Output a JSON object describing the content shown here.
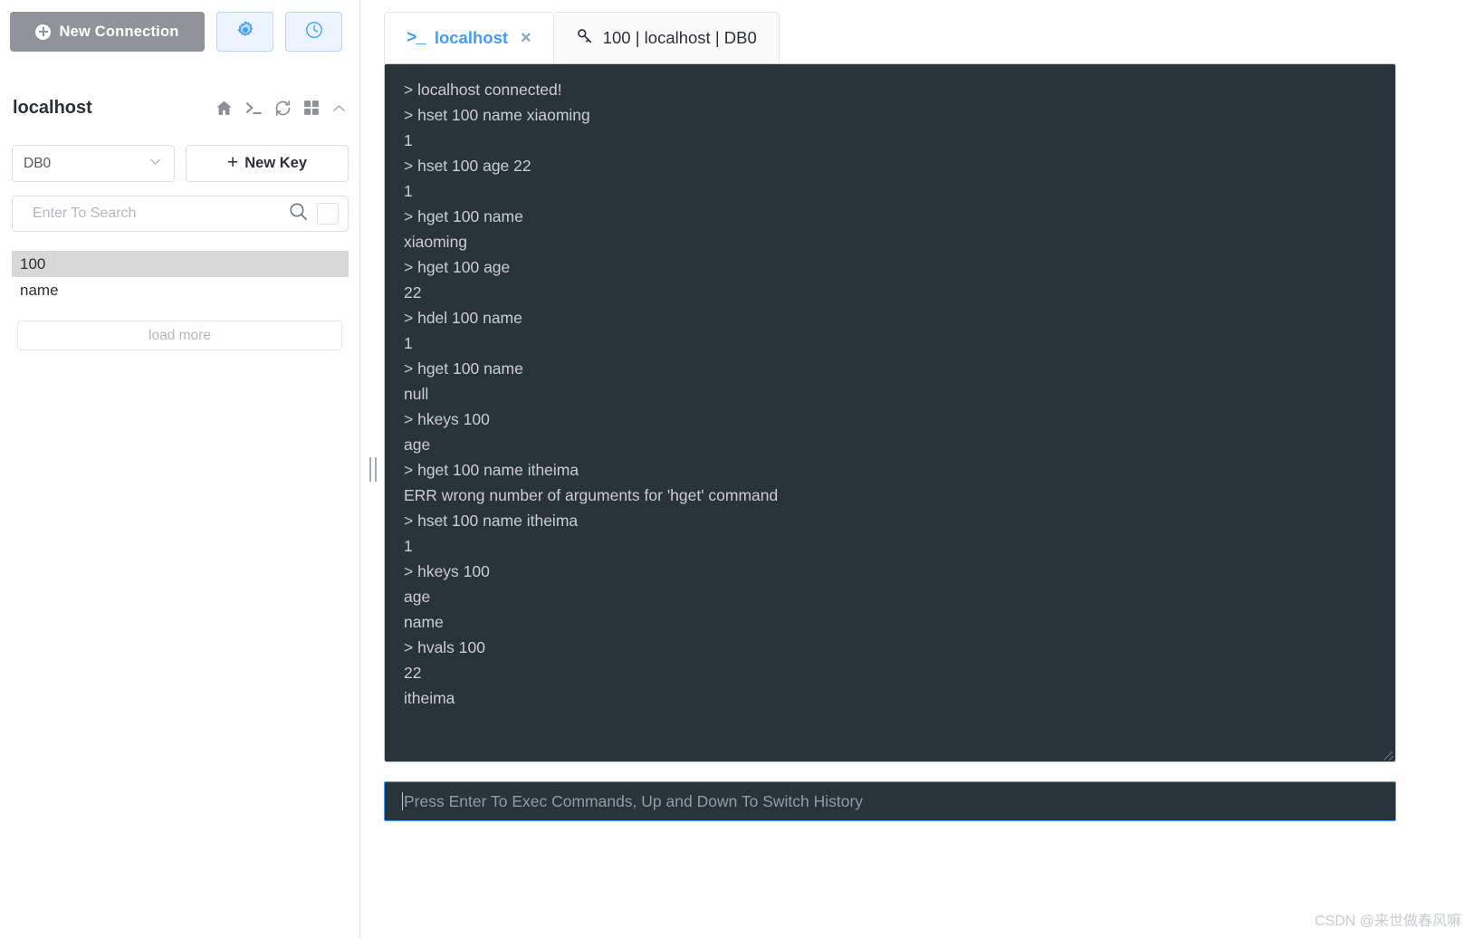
{
  "sidebar": {
    "new_connection_label": "New Connection",
    "settings_icon": "gear-icon",
    "history_icon": "clock-icon",
    "connection_title": "localhost",
    "header_icons": [
      "home-icon",
      "terminal-icon",
      "refresh-icon",
      "grid-icon",
      "chevron-up-icon"
    ],
    "db_select_value": "DB0",
    "new_key_label": "New Key",
    "search_placeholder": "Enter To Search",
    "search_value": "",
    "keys": [
      {
        "label": "100",
        "selected": true
      },
      {
        "label": "name",
        "selected": false
      }
    ],
    "load_more_label": "load more"
  },
  "tabs": [
    {
      "label": "localhost",
      "icon": "terminal-prompt-icon",
      "active": true,
      "closable": true,
      "close_label": "×"
    },
    {
      "label": "100 | localhost | DB0",
      "icon": "key-icon",
      "active": false,
      "closable": false
    }
  ],
  "console": {
    "lines": [
      "> localhost connected!",
      "> hset 100 name xiaoming",
      "1",
      "> hset 100 age 22",
      "1",
      "> hget 100 name",
      "xiaoming",
      "> hget 100 age",
      "22",
      "> hdel 100 name",
      "1",
      "> hget 100 name",
      "null",
      "> hkeys 100",
      "age",
      "> hget 100 name itheima",
      "ERR wrong number of arguments for 'hget' command",
      "> hset 100 name itheima",
      "1",
      "> hkeys 100",
      "age",
      "name",
      "> hvals 100",
      "22",
      "itheima"
    ]
  },
  "command_input": {
    "placeholder": "Press Enter To Exec Commands, Up and Down To Switch History",
    "value": ""
  },
  "watermark": "CSDN @来世做春风嘛",
  "colors": {
    "accent": "#409eff",
    "console_bg": "#29333a",
    "console_text": "#c9ced3",
    "button_gray": "#909399",
    "selected_key_bg": "#d8d8d8"
  }
}
